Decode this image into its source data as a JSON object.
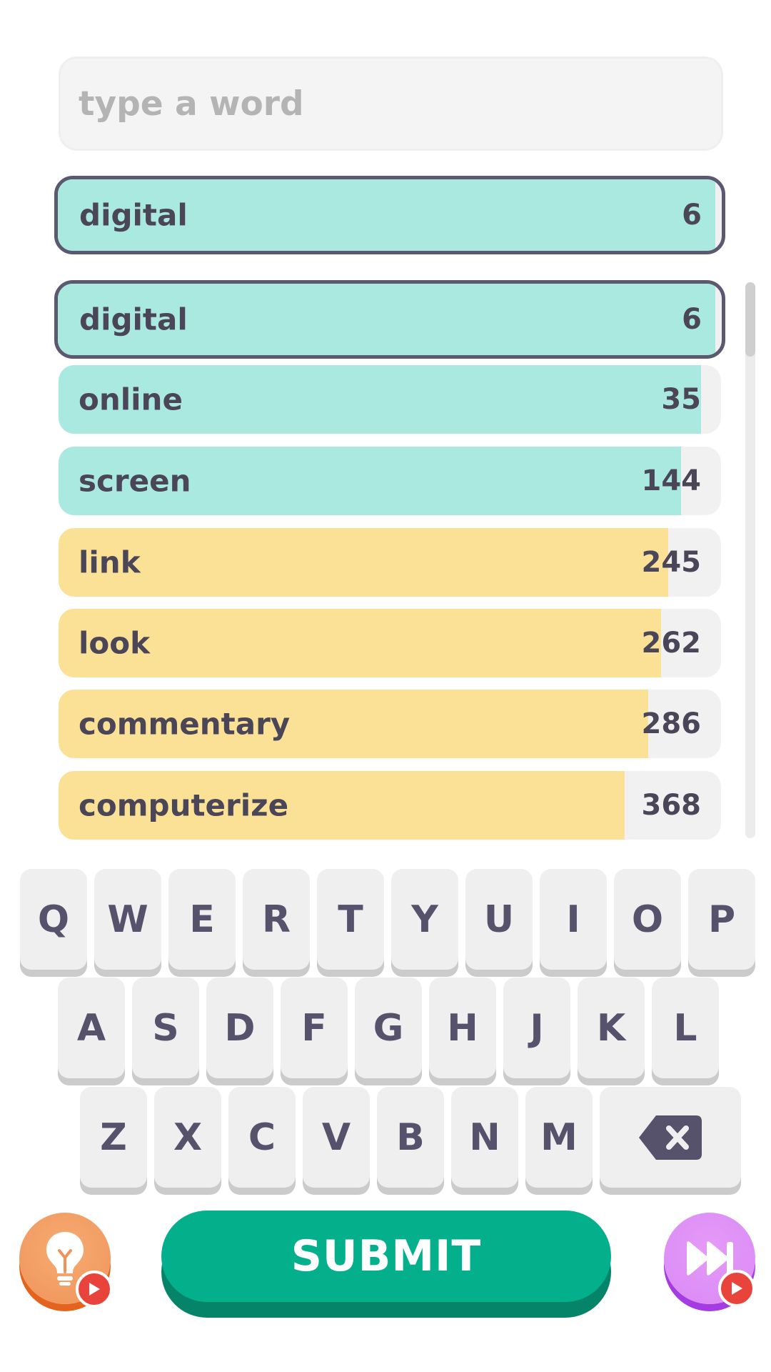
{
  "input": {
    "placeholder": "type a word",
    "value": ""
  },
  "current_guess": {
    "word": "digital",
    "rank": "6",
    "fill": 0.99,
    "color": "green"
  },
  "guesses": [
    {
      "word": "digital",
      "rank": "6",
      "fill": 0.99,
      "color": "green",
      "current": true
    },
    {
      "word": "online",
      "rank": "35",
      "fill": 0.97,
      "color": "green"
    },
    {
      "word": "screen",
      "rank": "144",
      "fill": 0.94,
      "color": "green"
    },
    {
      "word": "link",
      "rank": "245",
      "fill": 0.92,
      "color": "yellow"
    },
    {
      "word": "look",
      "rank": "262",
      "fill": 0.91,
      "color": "yellow"
    },
    {
      "word": "commentary",
      "rank": "286",
      "fill": 0.89,
      "color": "yellow"
    },
    {
      "word": "computerize",
      "rank": "368",
      "fill": 0.855,
      "color": "yellow"
    }
  ],
  "keyboard": {
    "row1": [
      "Q",
      "W",
      "E",
      "R",
      "T",
      "Y",
      "U",
      "I",
      "O",
      "P"
    ],
    "row2": [
      "A",
      "S",
      "D",
      "F",
      "G",
      "H",
      "J",
      "K",
      "L"
    ],
    "row3": [
      "Z",
      "X",
      "C",
      "V",
      "B",
      "N",
      "M"
    ],
    "backspace_icon": "backspace-icon"
  },
  "actions": {
    "submit_label": "SUBMIT",
    "hint_icon": "lightbulb-icon",
    "skip_icon": "fast-forward-icon",
    "ad_icon": "play-ad-icon"
  },
  "colors": {
    "green": "#aae9df",
    "yellow": "#fbe196",
    "submit": "#04b08c",
    "hint": "#f2995f",
    "skip": "#dc8ef6",
    "text": "#4a4658"
  }
}
